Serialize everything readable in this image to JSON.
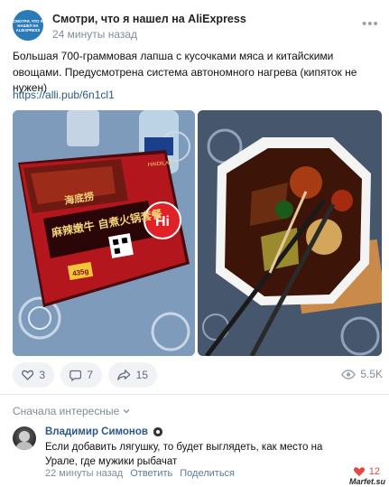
{
  "post": {
    "avatar_text": "СМОТРИ, ЧТО Я НАШЕЛ НА ALIEXPRESS",
    "author": "Смотри, что я нашел на AliExpress",
    "time": "24 минуты назад",
    "text": "Большая 700-граммовая лапша с кусочками мяса и китайскими овощами. Предусмотрена система автономного нагрева (кипяток не нужен)",
    "link": "https://alli.pub/6n1cl1",
    "photos": [
      {
        "name": "packaged-hot-pot",
        "brand": "海底捞",
        "title": "麻辣嫩牛 自煮火锅套餐",
        "logo": "Hi",
        "weight": "435g",
        "label": "HAIDILAO"
      },
      {
        "name": "cooked-hot-pot"
      }
    ]
  },
  "actions": {
    "likes": "3",
    "comments": "7",
    "shares": "15",
    "views": "5.5K"
  },
  "comments_section": {
    "sort_label": "Сначала интересные",
    "comment": {
      "author": "Владимир Симонов",
      "text": "Если добавить лягушку, то будет выглядеть, как место на Урале, где мужики рыбачат",
      "time": "22 минуты назад",
      "reply_label": "Ответить",
      "share_label": "Поделиться",
      "likes": "12"
    }
  },
  "watermark": "Marfet.su",
  "colors": {
    "link": "#2a5885",
    "accent": "#2a7ab8",
    "muted": "#818c99",
    "like_red": "#e64646"
  }
}
